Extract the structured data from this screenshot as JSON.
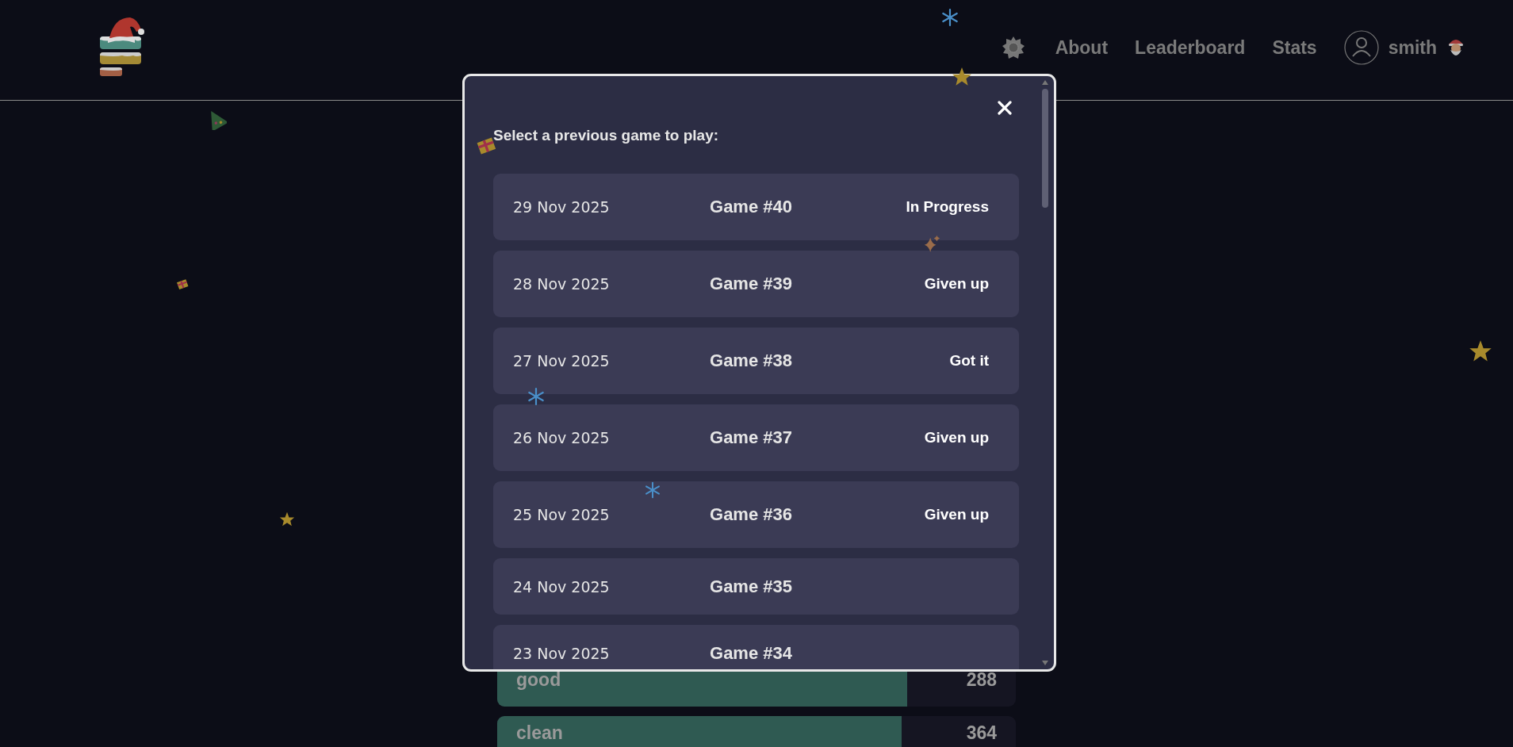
{
  "header": {
    "nav": [
      {
        "label": "About"
      },
      {
        "label": "Leaderboard"
      },
      {
        "label": "Stats"
      }
    ],
    "user": {
      "name": "smith"
    }
  },
  "modal": {
    "title": "Select a previous game to play:",
    "games": [
      {
        "date": "29 Nov 2025",
        "game": "Game #40",
        "status": "In Progress"
      },
      {
        "date": "28 Nov 2025",
        "game": "Game #39",
        "status": "Given up"
      },
      {
        "date": "27 Nov 2025",
        "game": "Game #38",
        "status": "Got it"
      },
      {
        "date": "26 Nov 2025",
        "game": "Game #37",
        "status": "Given up"
      },
      {
        "date": "25 Nov 2025",
        "game": "Game #36",
        "status": "Given up"
      },
      {
        "date": "24 Nov 2025",
        "game": "Game #35"
      },
      {
        "date": "23 Nov 2025",
        "game": "Game #34"
      }
    ]
  },
  "results": [
    {
      "word": "good",
      "count": "288",
      "level": 0.79
    },
    {
      "word": "clean",
      "count": "364",
      "level": 0.78
    }
  ]
}
